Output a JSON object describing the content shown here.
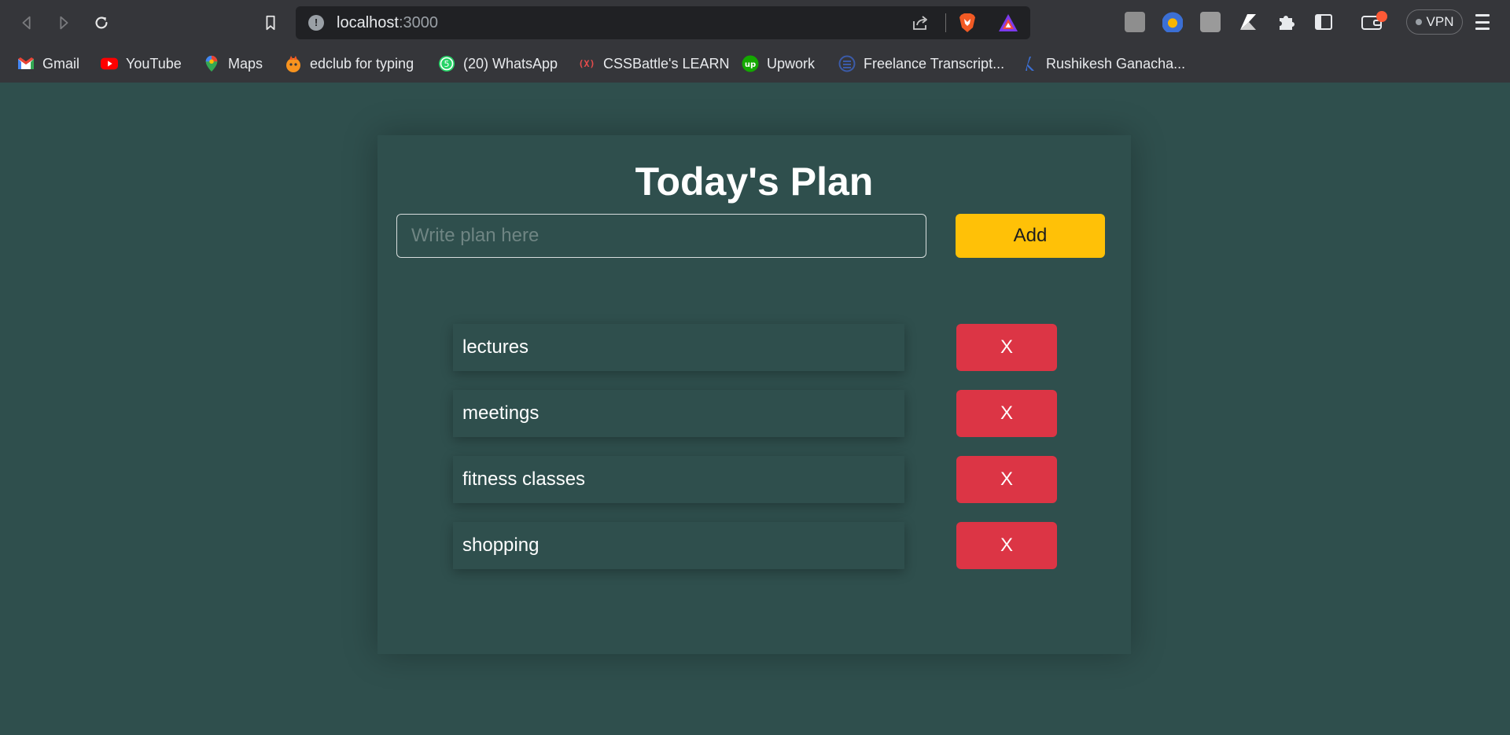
{
  "browser": {
    "url_host": "localhost",
    "url_port": ":3000",
    "vpn_label": "VPN",
    "bookmarks": [
      {
        "label": "Gmail",
        "icon": "gmail-icon"
      },
      {
        "label": "YouTube",
        "icon": "youtube-icon"
      },
      {
        "label": "Maps",
        "icon": "maps-icon"
      },
      {
        "label": "edclub for typing",
        "icon": "edclub-icon"
      },
      {
        "label": "(20) WhatsApp",
        "icon": "whatsapp-icon"
      },
      {
        "label": "CSSBattle's LEARN",
        "icon": "cssbattle-icon"
      },
      {
        "label": "Upwork",
        "icon": "upwork-icon"
      },
      {
        "label": "Freelance Transcript...",
        "icon": "transcript-icon"
      },
      {
        "label": "Rushikesh Ganacha...",
        "icon": "profile-icon"
      }
    ]
  },
  "app": {
    "title": "Today's Plan",
    "input_placeholder": "Write plan here",
    "input_value": "",
    "add_label": "Add",
    "delete_label": "X",
    "plans": [
      "lectures",
      "meetings",
      "fitness classes",
      "shopping"
    ]
  },
  "colors": {
    "background": "#2f4f4d",
    "add_button": "#ffc107",
    "delete_button": "#dc3545"
  }
}
